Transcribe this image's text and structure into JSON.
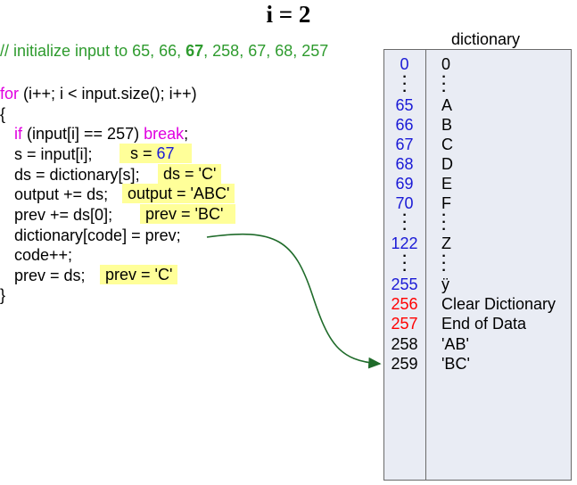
{
  "title": "i = 2",
  "comment": {
    "prefix": "// initialize input to 65, 66, ",
    "bold": "67",
    "suffix": ", 258, 67, 68, 257"
  },
  "code": {
    "for_kw": "for",
    "for_rest": " (i++; i < input.size(); i++)",
    "open_brace": "{",
    "if_kw": "if",
    "if_mid": " (input[i] == 257) ",
    "break_kw": "break",
    "if_end": ";",
    "line_s": "s = input[i];",
    "line_ds": "ds = dictionary[s];",
    "line_output": "output += ds;",
    "line_prev": "prev += ds[0];",
    "line_dict": "dictionary[code] = prev;",
    "line_code": "code++;",
    "line_prev2": "prev = ds;",
    "close_brace": "}"
  },
  "highlights": {
    "s_label": "s = ",
    "s_value": "67",
    "ds": "ds = 'C'",
    "output": "output = 'ABC'",
    "prev": "prev = 'BC'",
    "prev2": "prev = 'C'"
  },
  "dictionary": {
    "title": "dictionary",
    "rows": [
      {
        "index": "0",
        "value": "0",
        "color": "#1a1ad6"
      },
      {
        "index": "65",
        "value": "A",
        "color": "#1a1ad6"
      },
      {
        "index": "66",
        "value": "B",
        "color": "#1a1ad6"
      },
      {
        "index": "67",
        "value": "C",
        "color": "#1a1ad6"
      },
      {
        "index": "68",
        "value": "D",
        "color": "#1a1ad6"
      },
      {
        "index": "69",
        "value": "E",
        "color": "#1a1ad6"
      },
      {
        "index": "70",
        "value": "F",
        "color": "#1a1ad6"
      },
      {
        "index": "122",
        "value": "Z",
        "color": "#1a1ad6"
      },
      {
        "index": "255",
        "value": "ÿ",
        "color": "#1a1ad6"
      },
      {
        "index": "256",
        "value": "Clear Dictionary",
        "color": "#ff0000"
      },
      {
        "index": "257",
        "value": "End of Data",
        "color": "#ff0000"
      },
      {
        "index": "258",
        "value": "'AB'",
        "color": "#000000"
      },
      {
        "index": "259",
        "value": "'BC'",
        "color": "#000000"
      }
    ]
  },
  "colors": {
    "keyword": "#e000e0",
    "comment": "#2e9b2e",
    "highlight": "#ffff99",
    "arrow": "#1f6b2a",
    "dict_bg": "#e9ecf4"
  }
}
